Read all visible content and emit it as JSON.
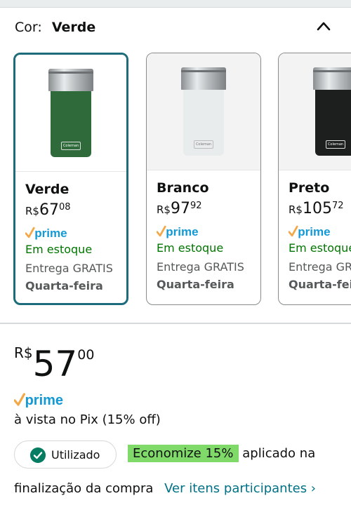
{
  "color_selector": {
    "label": "Cor:",
    "selected": "Verde"
  },
  "variants": [
    {
      "name": "Verde",
      "currency": "R$",
      "price_whole": "67",
      "price_cents": "08",
      "prime": "prime",
      "stock": "Em estoque",
      "shipping": "Entrega GRATIS",
      "delivery_day": "Quarta-feira",
      "badge": "Coleman",
      "body_color": "#2f6b3a"
    },
    {
      "name": "Branco",
      "currency": "R$",
      "price_whole": "97",
      "price_cents": "92",
      "prime": "prime",
      "stock": "Em estoque",
      "shipping": "Entrega GRATIS",
      "delivery_day": "Quarta-feira",
      "badge": "Coleman",
      "body_color": "#e9ecec"
    },
    {
      "name": "Preto",
      "currency": "R$",
      "price_whole": "105",
      "price_cents": "72",
      "prime": "prime",
      "stock": "Em estoque",
      "shipping": "Entrega GRATIS",
      "delivery_day": "Quarta-feira",
      "badge": "Coleman",
      "body_color": "#1d1f1f"
    }
  ],
  "price": {
    "currency": "R$",
    "whole": "57",
    "cents": "00"
  },
  "prime_label": "prime",
  "pix_note": "à vista no Pix (15% off)",
  "coupon": {
    "badge": "Utilizado",
    "highlight": "Economize 15%",
    "text_after": "aplicado na",
    "line2": "finalização da compra",
    "link": "Ver itens participantes ›"
  },
  "colors": {
    "prime_blue": "#1399d6",
    "prime_check": "#f3a847",
    "stock_green": "#007600",
    "link": "#007185",
    "selected_border": "#1e6b7b",
    "highlight": "#7fda69"
  }
}
